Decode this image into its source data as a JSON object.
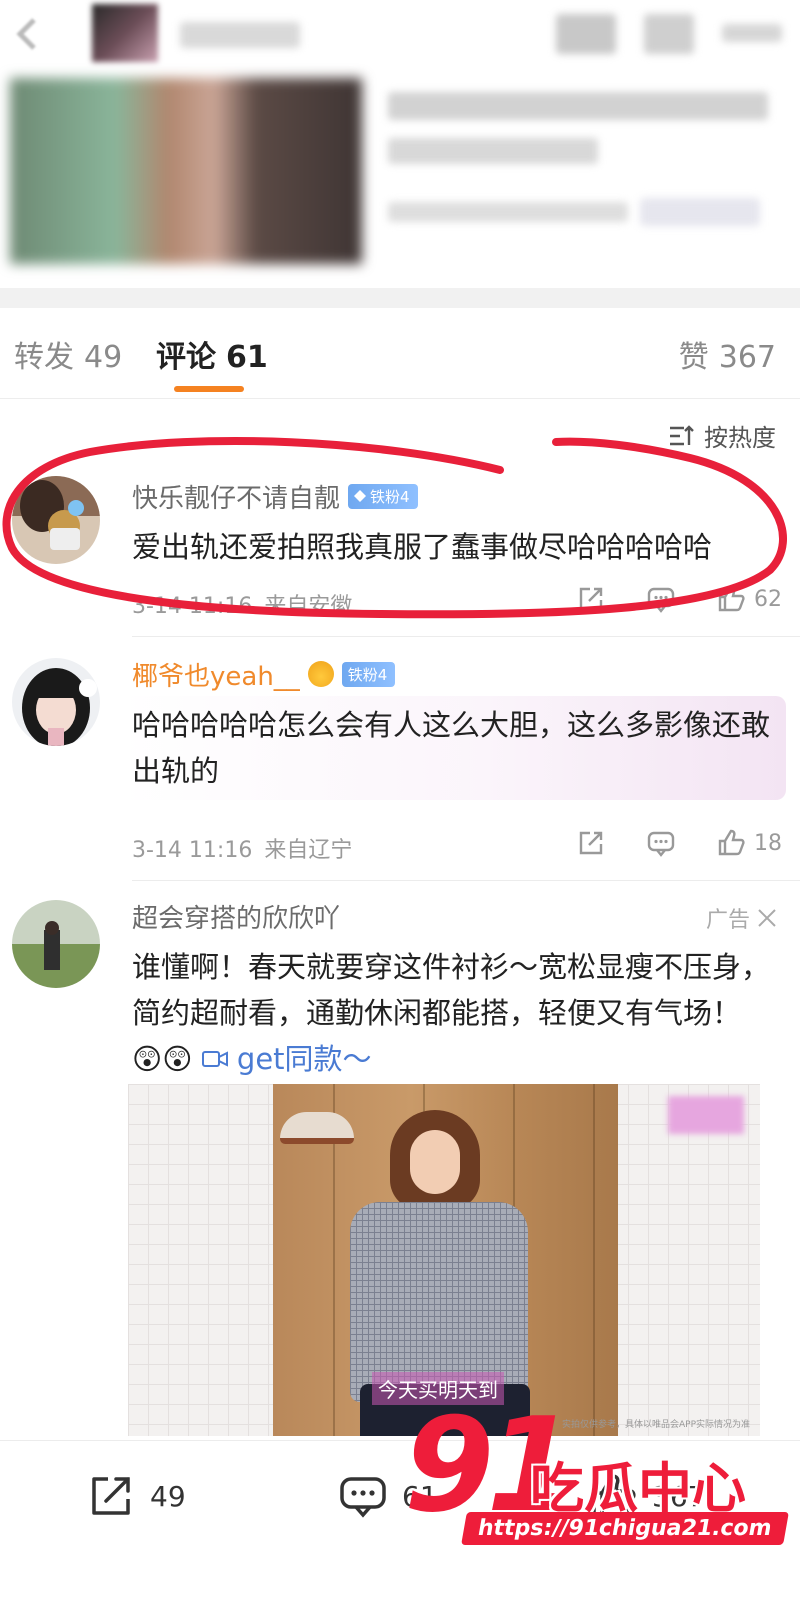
{
  "tabs": {
    "repost": {
      "label": "转发",
      "count": "49"
    },
    "comments": {
      "label": "评论",
      "count": "61"
    },
    "likes": {
      "label": "赞",
      "count": "367"
    }
  },
  "sort": {
    "label": "按热度"
  },
  "comments": [
    {
      "user": "快乐靓仔不请自靓",
      "badge": "铁粉4",
      "text": "爱出轨还爱拍照我真服了蠢事做尽哈哈哈哈哈",
      "time": "3-14 11:16",
      "location": "来自安徽",
      "likes": "62"
    },
    {
      "user": "椰爷也yeah__",
      "badge": "铁粉4",
      "text": "哈哈哈哈哈怎么会有人这么大胆，这么多影像还敢出轨的",
      "time": "3-14 11:16",
      "location": "来自辽宁",
      "likes": "18"
    }
  ],
  "ad": {
    "user": "超会穿搭的欣欣吖",
    "tag": "广告",
    "text": "谁懂啊！春天就要穿这件衬衫～宽松显瘦不压身，简约超耐看，通勤休闲都能搭，轻便又有气场！",
    "emoji": "😲😲",
    "link": "get同款～",
    "image_caption": "今天买明天到",
    "fine_print": "实拍仅供参考，具体以唯品会APP实际情况为准"
  },
  "bottom_bar": {
    "repost_count": "49",
    "comment_count": "61",
    "like_count": "367"
  },
  "watermark": {
    "logo": "91",
    "name": "吃瓜中心",
    "url": "https://91chigua21.com"
  },
  "colors": {
    "accent": "#f58221",
    "vip_name": "#f08a2c",
    "link": "#4a7bd3",
    "annotation_red": "#e8203a",
    "watermark_red": "#ee1d3a"
  }
}
